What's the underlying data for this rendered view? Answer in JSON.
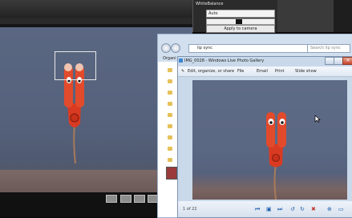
{
  "white_balance": {
    "label": "WhiteBalance",
    "mode_value": "Auto",
    "apply_button": "Apply to camera"
  },
  "explorer": {
    "address": "lip sync",
    "search_placeholder": "Search lip sync",
    "organize_label": "Organi"
  },
  "gallery": {
    "title": "IMG_0028 - Windows Live Photo Gallery",
    "toolbar": {
      "edit_label": "Edit, organize, or share",
      "file_label": "File",
      "email_label": "Email",
      "print_label": "Print",
      "slideshow_label": "Slide show"
    },
    "counter": "1 of 22",
    "close_glyph": "✕"
  },
  "icons": {
    "back": "back-arrow-icon",
    "forward": "forward-arrow-icon",
    "folder": "folder-icon",
    "previous": "previous-icon",
    "slideshow": "slideshow-icon",
    "next": "next-icon",
    "rotate_left": "rotate-left-icon",
    "rotate_right": "rotate-right-icon",
    "delete": "delete-icon",
    "zoom": "zoom-icon"
  },
  "colors": {
    "robot_red": "#d93a22",
    "gallery_frame": "#c9d9ea",
    "liveview_bg": "#5a6782"
  }
}
